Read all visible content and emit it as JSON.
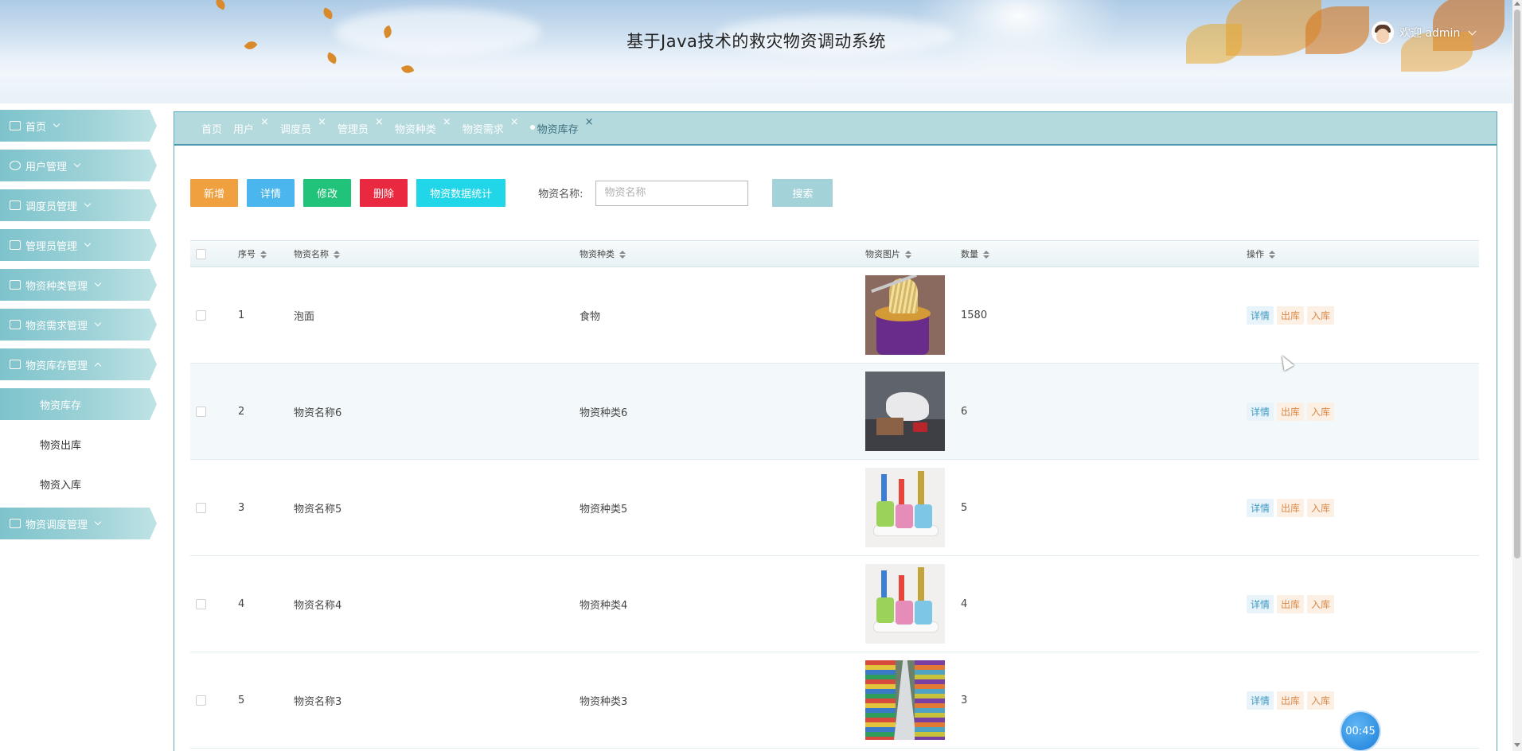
{
  "header": {
    "title": "基于Java技术的救灾物资调动系统",
    "welcome": "欢迎 admin"
  },
  "sidebar": {
    "items": [
      {
        "label": "首页",
        "icon": "home-icon"
      },
      {
        "label": "用户管理",
        "icon": "user-icon"
      },
      {
        "label": "调度员管理",
        "icon": "briefcase-icon"
      },
      {
        "label": "管理员管理",
        "icon": "card-icon"
      },
      {
        "label": "物资种类管理",
        "icon": "copy-icon"
      },
      {
        "label": "物资需求管理",
        "icon": "printer-icon"
      },
      {
        "label": "物资库存管理",
        "icon": "wallet-icon",
        "expanded": true
      },
      {
        "label": "物资调度管理",
        "icon": "id-badge-icon"
      }
    ],
    "submenu": [
      {
        "label": "物资库存",
        "active": true
      },
      {
        "label": "物资出库"
      },
      {
        "label": "物资入库"
      }
    ]
  },
  "tabs": [
    {
      "label": "首页",
      "closable": false
    },
    {
      "label": "用户",
      "closable": true
    },
    {
      "label": "调度员",
      "closable": true
    },
    {
      "label": "管理员",
      "closable": true
    },
    {
      "label": "物资种类",
      "closable": true
    },
    {
      "label": "物资需求",
      "closable": true
    },
    {
      "label": "物资库存",
      "closable": true,
      "active": true
    }
  ],
  "toolbar": {
    "add_label": "新增",
    "detail_label": "详情",
    "edit_label": "修改",
    "delete_label": "删除",
    "stats_label": "物资数据统计",
    "search_label": "物资名称:",
    "search_placeholder": "物资名称",
    "search_value": "",
    "search_button": "搜索"
  },
  "table": {
    "columns": [
      "序号",
      "物资名称",
      "物资种类",
      "物资图片",
      "数量",
      "操作"
    ],
    "rows": [
      {
        "idx": "1",
        "name": "泡面",
        "type": "食物",
        "image": "instant-noodle-image",
        "qty": "1580"
      },
      {
        "idx": "2",
        "name": "物资名称6",
        "type": "物资种类6",
        "image": "bag-image",
        "qty": "6"
      },
      {
        "idx": "3",
        "name": "物资名称5",
        "type": "物资种类5",
        "image": "cups-image",
        "qty": "5"
      },
      {
        "idx": "4",
        "name": "物资名称4",
        "type": "物资种类4",
        "image": "cups-image",
        "qty": "4"
      },
      {
        "idx": "5",
        "name": "物资名称3",
        "type": "物资种类3",
        "image": "store-aisle-image",
        "qty": "3"
      }
    ],
    "ops": {
      "detail": "详情",
      "out": "出库",
      "in": "入库"
    }
  },
  "timer": "00:45",
  "colors": {
    "accent": "#7ec3cc",
    "add": "#f0a03e",
    "detail": "#4bb6ee",
    "edit": "#21c27a",
    "delete": "#e8293f",
    "stats": "#20d6e8",
    "search": "#a3d3d8"
  }
}
